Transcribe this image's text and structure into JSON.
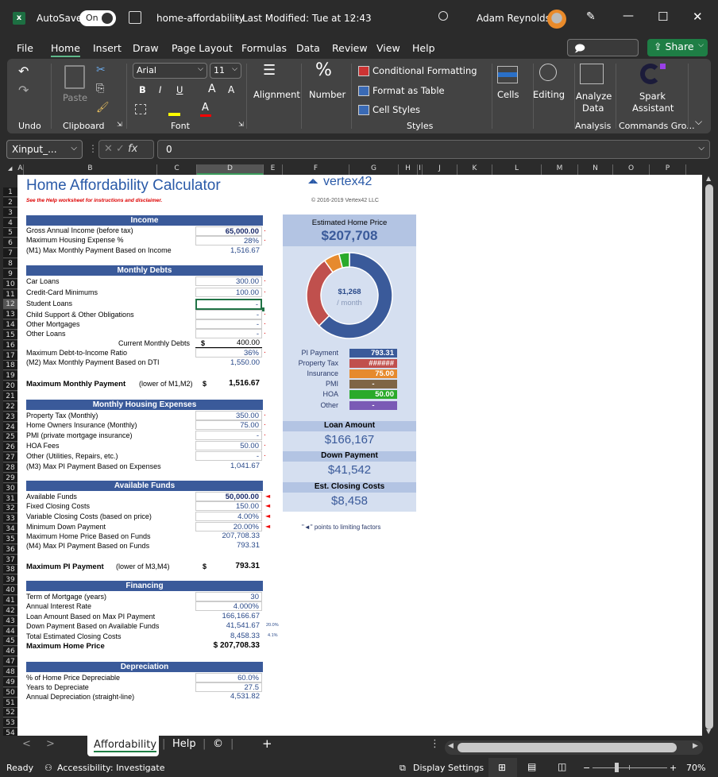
{
  "titlebar": {
    "autosave_label": "AutoSave",
    "autosave_state": "On",
    "document_title": "home-affordability",
    "last_modified": "Last Modified: Tue at 12:43",
    "user_name": "Adam Reynolds",
    "minimize": "—",
    "maximize": "☐",
    "close": "✕"
  },
  "menu": {
    "items": [
      "File",
      "Home",
      "Insert",
      "Draw",
      "Page Layout",
      "Formulas",
      "Data",
      "Review",
      "View",
      "Help"
    ],
    "active": "Home",
    "comments_label": "Comments",
    "share_label": "Share"
  },
  "ribbon": {
    "groups": {
      "undo": "Undo",
      "clipboard": "Clipboard",
      "font": "Font",
      "styles": "Styles",
      "analysis": "Analysis",
      "commands": "Commands Gro..."
    },
    "paste_label": "Paste",
    "font_name": "Arial",
    "font_size": "11",
    "bold": "B",
    "italic": "I",
    "underline": "U",
    "grow_font": "A",
    "shrink_font": "A",
    "alignment_label": "Alignment",
    "number_label": "Number",
    "conditional_formatting": "Conditional Formatting",
    "format_as_table": "Format as Table",
    "cell_styles": "Cell Styles",
    "cells_label": "Cells",
    "editing_label": "Editing",
    "analyze_data_label1": "Analyze",
    "analyze_data_label2": "Data",
    "spark_label1": "Spark",
    "spark_label2": "Assistant",
    "colors": {
      "highlight": "#ffff00",
      "font_color": "#ff0000"
    }
  },
  "formula_bar": {
    "name_box": "Xinput_...",
    "fx": "fx",
    "formula": "0"
  },
  "columns": [
    "A",
    "B",
    "C",
    "D",
    "E",
    "F",
    "G",
    "H",
    "I",
    "J",
    "K",
    "L",
    "M",
    "N",
    "O",
    "P"
  ],
  "selected_column": "D",
  "rows": [
    "1",
    "2",
    "3",
    "4",
    "5",
    "6",
    "7",
    "8",
    "9",
    "10",
    "11",
    "12",
    "13",
    "14",
    "15",
    "16",
    "17",
    "18",
    "19",
    "20",
    "21",
    "22",
    "23",
    "24",
    "25",
    "26",
    "27",
    "28",
    "29",
    "30",
    "31",
    "32",
    "33",
    "34",
    "35",
    "36",
    "37",
    "38",
    "39",
    "40",
    "41",
    "42",
    "43",
    "44",
    "45",
    "46",
    "47",
    "48",
    "49",
    "50",
    "51",
    "52",
    "53",
    "54"
  ],
  "selected_row": "12",
  "sheet": {
    "title": "Home Affordability Calculator",
    "subtitle": "See the Help worksheet for instructions and disclaimer.",
    "logo_text": "vertex42",
    "copyright": "© 2016-2019 Vertex42 LLC",
    "income": {
      "header": "Income",
      "rows": [
        {
          "label": "Gross Annual Income (before tax)",
          "value": "65,000.00"
        },
        {
          "label": "Maximum Housing Expense %",
          "value": "28%"
        },
        {
          "label": "(M1) Max Monthly Payment Based on Income",
          "value": "1,516.67"
        }
      ]
    },
    "debts": {
      "header": "Monthly Debts",
      "rows": [
        {
          "label": "Car Loans",
          "value": "300.00"
        },
        {
          "label": "Credit-Card Minimums",
          "value": "100.00"
        },
        {
          "label": "Student Loans",
          "value": "-"
        },
        {
          "label": "Child Support & Other Obligations",
          "value": "-"
        },
        {
          "label": "Other Mortgages",
          "value": "-"
        },
        {
          "label": "Other Loans",
          "value": "-"
        }
      ],
      "current_label": "Current Monthly Debts",
      "current_currency": "$",
      "current_value": "400.00",
      "dti_label": "Maximum Debt-to-Income Ratio",
      "dti_value": "36%",
      "m2_label": "(M2) Max Monthly Payment Based on DTI",
      "m2_value": "1,550.00",
      "max_label": "Maximum Monthly Payment",
      "max_note": "(lower of M1,M2)",
      "max_currency": "$",
      "max_value": "1,516.67"
    },
    "housing": {
      "header": "Monthly Housing Expenses",
      "rows": [
        {
          "label": "Property Tax (Monthly)",
          "value": "350.00"
        },
        {
          "label": "Home Owners Insurance (Monthly)",
          "value": "75.00"
        },
        {
          "label": "PMI (private mortgage insurance)",
          "value": "-"
        },
        {
          "label": "HOA Fees",
          "value": "50.00"
        },
        {
          "label": "Other (Utilities, Repairs, etc.)",
          "value": "-"
        }
      ],
      "m3_label": "(M3) Max PI Payment Based on Expenses",
      "m3_value": "1,041.67"
    },
    "funds": {
      "header": "Available Funds",
      "rows": [
        {
          "label": "Available Funds",
          "value": "50,000.00"
        },
        {
          "label": "Fixed Closing Costs",
          "value": "150.00"
        },
        {
          "label": "Variable Closing Costs (based on price)",
          "value": "4.00%"
        },
        {
          "label": "Minimum Down Payment",
          "value": "20.00%"
        }
      ],
      "max_price_label": "Maximum Home Price Based on Funds",
      "max_price_value": "207,708.33",
      "m4_label": "(M4) Max PI Payment Based on Funds",
      "m4_value": "793.31",
      "max_pi_label": "Maximum PI Payment",
      "max_pi_note": "(lower of M3,M4)",
      "max_pi_currency": "$",
      "max_pi_value": "793.31"
    },
    "financing": {
      "header": "Financing",
      "term_label": "Term of Mortgage (years)",
      "term_value": "30",
      "rate_label": "Annual Interest Rate",
      "rate_value": "4.000%",
      "loan_label": "Loan Amount Based on Max PI Payment",
      "loan_value": "166,166.67",
      "down_label": "Down Payment Based on Available Funds",
      "down_value": "41,541.67",
      "down_pct": "20.0%",
      "closing_label": "Total Estimated Closing Costs",
      "closing_value": "8,458.33",
      "closing_pct": "4.1%",
      "max_label": "Maximum Home Price",
      "max_value": "$ 207,708.33"
    },
    "depreciation": {
      "header": "Depreciation",
      "pct_label": "% of Home Price Depreciable",
      "pct_value": "60.0%",
      "years_label": "Years to Depreciate",
      "years_value": "27.5",
      "annual_label": "Annual Depreciation (straight-line)",
      "annual_value": "4,531.82"
    },
    "limiting_note": "\"◄\" points to limiting factors",
    "limiting_marker": "◄",
    "change_marker": "."
  },
  "panel": {
    "est_price_label": "Estimated Home Price",
    "est_price_value": "$207,708",
    "donut_center_value": "$1,268",
    "donut_center_unit": "/ month",
    "legend": [
      {
        "label": "PI Payment",
        "value": "793.31",
        "color": "#3a5a9a"
      },
      {
        "label": "Property Tax",
        "value": "######",
        "color": "#c0504d"
      },
      {
        "label": "Insurance",
        "value": "75.00",
        "color": "#e68a2e"
      },
      {
        "label": "PMI",
        "value": "-",
        "color": "#7f6545"
      },
      {
        "label": "HOA",
        "value": "50.00",
        "color": "#2aaa2a"
      },
      {
        "label": "Other",
        "value": "-",
        "color": "#7a5ab5"
      }
    ],
    "loan_amount_label": "Loan Amount",
    "loan_amount_value": "$166,167",
    "down_payment_label": "Down Payment",
    "down_payment_value": "$41,542",
    "closing_label": "Est. Closing Costs",
    "closing_value": "$8,458"
  },
  "chart_data": {
    "type": "pie",
    "subtype": "donut",
    "title": "",
    "categories": [
      "PI Payment",
      "Property Tax",
      "Insurance",
      "PMI",
      "HOA",
      "Other"
    ],
    "values": [
      793.31,
      350.0,
      75.0,
      0,
      50.0,
      0
    ],
    "colors": [
      "#3a5a9a",
      "#c0504d",
      "#e68a2e",
      "#7f6545",
      "#2aaa2a",
      "#7a5ab5"
    ],
    "center_label": "$1,268 / month",
    "legend": "below"
  },
  "sheet_tabs": {
    "prev": "<",
    "next": ">",
    "tabs": [
      "Affordability",
      "Help",
      "©"
    ],
    "active": "Affordability",
    "add": "+"
  },
  "statusbar": {
    "ready": "Ready",
    "accessibility": "Accessibility: Investigate",
    "display_settings": "Display Settings",
    "zoom_minus": "−",
    "zoom_plus": "+",
    "zoom_level": "70%",
    "zoom_fraction": 0.7
  }
}
